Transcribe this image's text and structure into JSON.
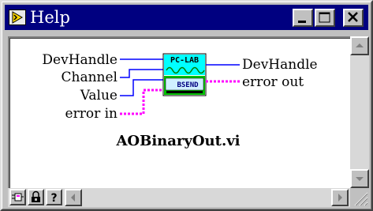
{
  "window": {
    "title": "Help",
    "controls": {
      "minimize": "minimize",
      "maximize": "maximize",
      "close": "close"
    }
  },
  "vi": {
    "name": "AOBinaryOut.vi",
    "icon_top_text": "PC-LAB",
    "icon_bottom_text": "BSEND",
    "inputs": [
      {
        "label": "DevHandle",
        "wire": "blue"
      },
      {
        "label": "Channel",
        "wire": "blue"
      },
      {
        "label": "Value",
        "wire": "blue"
      },
      {
        "label": "error in",
        "wire": "pink"
      }
    ],
    "outputs": [
      {
        "label": "DevHandle",
        "wire": "blue"
      },
      {
        "label": "error out",
        "wire": "pink"
      }
    ]
  },
  "toolbar": {
    "buttons": [
      {
        "name": "simple-diagram-icon"
      },
      {
        "name": "lock-icon"
      },
      {
        "name": "question-icon",
        "text": "?"
      }
    ]
  },
  "colors": {
    "titlebar": "#000080",
    "wire_numeric": "#0000ff",
    "wire_error": "#ff00ff",
    "icon_top_bg": "#00ffff",
    "icon_bottom_bg": "#00c000"
  }
}
